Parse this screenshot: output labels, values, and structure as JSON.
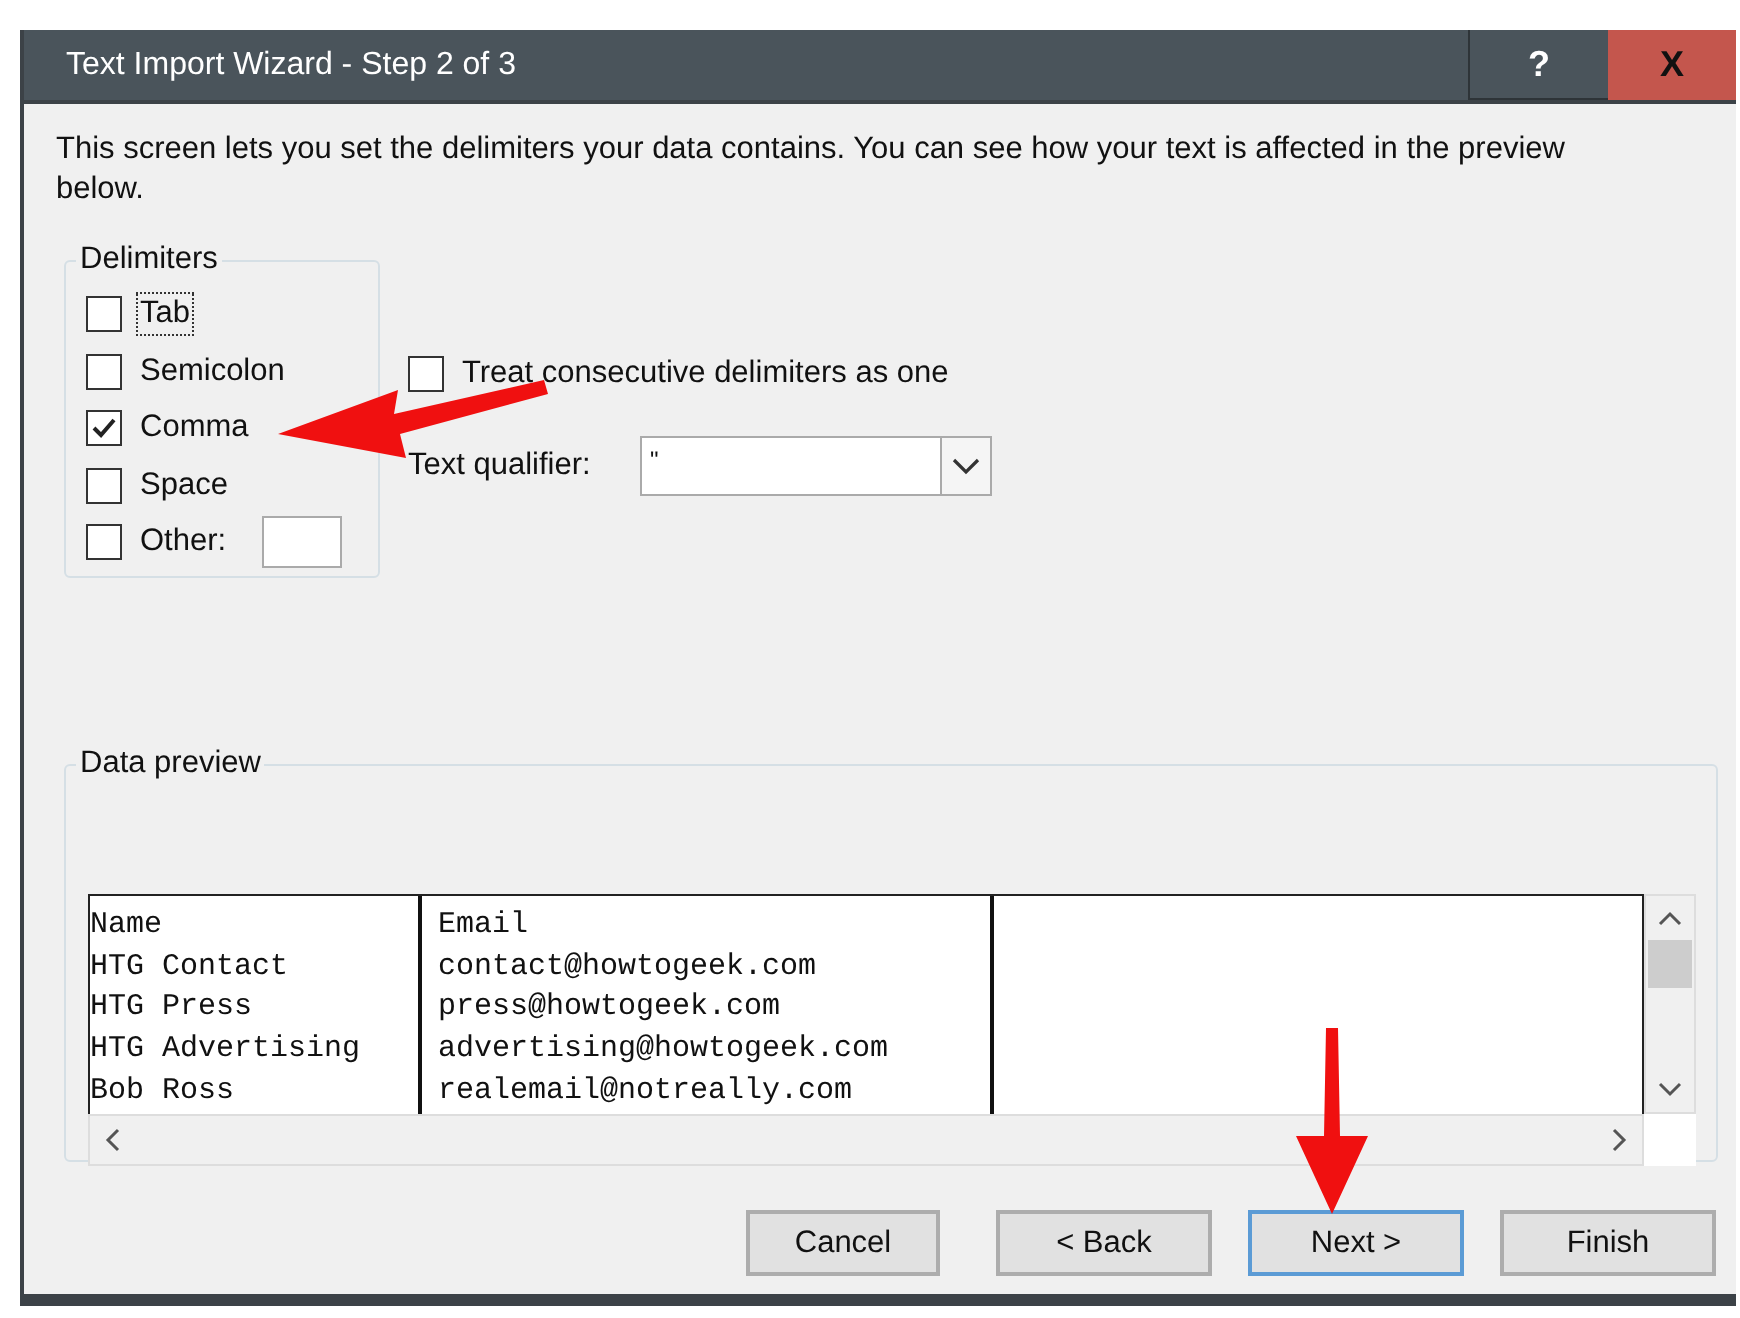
{
  "window": {
    "title": "Text Import Wizard - Step 2 of 3",
    "help_button": "?",
    "close_button": "X"
  },
  "intro": "This screen lets you set the delimiters your data contains.  You can see how your text is affected in the preview below.",
  "delimiters": {
    "title": "Delimiters",
    "items": [
      {
        "label": "Tab",
        "checked": false,
        "focused": true,
        "kind": "plain"
      },
      {
        "label": "Semicolon",
        "checked": false,
        "focused": false,
        "kind": "plain"
      },
      {
        "label": "Comma",
        "checked": true,
        "focused": false,
        "kind": "plain"
      },
      {
        "label": "Space",
        "checked": false,
        "focused": false,
        "kind": "plain"
      },
      {
        "label": "Other:",
        "checked": false,
        "focused": false,
        "kind": "other"
      }
    ]
  },
  "treat_consecutive": {
    "label": "Treat consecutive delimiters as one",
    "checked": false
  },
  "text_qualifier": {
    "label": "Text qualifier:",
    "value": "\""
  },
  "data_preview": {
    "title": "Data preview",
    "columns": [
      {
        "cells": [
          "Name",
          "HTG Contact",
          "HTG Press",
          "HTG Advertising",
          "Bob Ross"
        ]
      },
      {
        "cells": [
          "Email",
          "contact@howtogeek.com",
          "press@howtogeek.com",
          "advertising@howtogeek.com",
          "realemail@notreally.com"
        ]
      },
      {}
    ]
  },
  "buttons": [
    {
      "label": "Cancel",
      "focused": false
    },
    {
      "label": "< Back",
      "focused": false
    },
    {
      "label": "Next >",
      "focused": true
    },
    {
      "label": "Finish",
      "focused": false
    }
  ]
}
